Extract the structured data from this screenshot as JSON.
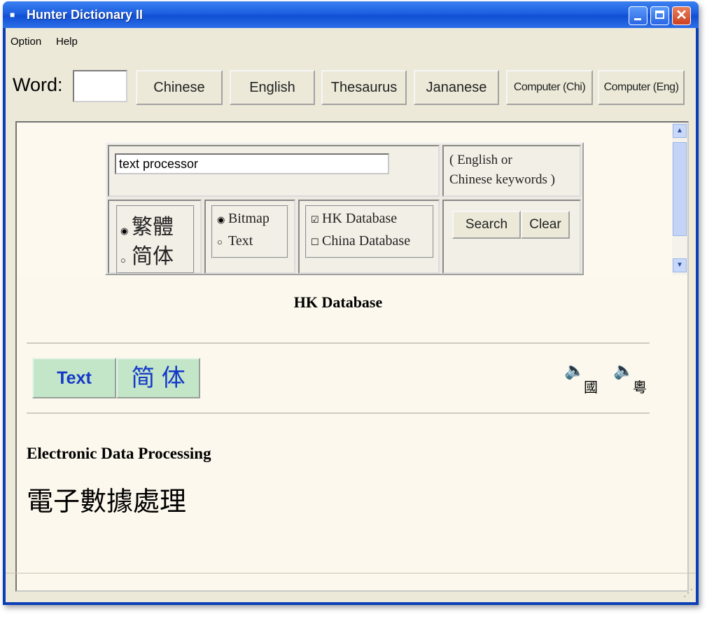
{
  "window": {
    "title": "Hunter Dictionary II",
    "close_glyph": "✕"
  },
  "menu": {
    "items": [
      "Option",
      "Help"
    ]
  },
  "toolbar": {
    "word_label": "Word:",
    "word_value": "",
    "buttons": [
      "Chinese",
      "English",
      "Thesaurus",
      "Jananese",
      "Computer (Chi)",
      "Computer (Eng)"
    ]
  },
  "search": {
    "query": "text processor",
    "hint_line1": "( English or",
    "hint_line2": "Chinese keywords )",
    "script_options": {
      "traditional": "繁體",
      "simplified": "简体",
      "selected": "traditional"
    },
    "render_options": {
      "bitmap": "Bitmap",
      "text": "Text",
      "selected": "bitmap"
    },
    "databases": {
      "hk": "HK Database",
      "china": "China Database",
      "hk_checked": true,
      "china_checked": false
    },
    "search_label": "Search",
    "clear_label": "Clear"
  },
  "result": {
    "database_title": "HK Database",
    "mode_text": "Text",
    "mode_simplified": "简 体",
    "pron_mandarin": "國",
    "pron_cantonese": "粵",
    "term_english": "Electronic Data Processing",
    "term_chinese": "電子數據處理"
  },
  "icons": {
    "speaker": "speaker-icon",
    "app": "book-icon"
  },
  "colors": {
    "titlebar": "#1d5fe0",
    "mode_button_bg": "#c3e6c9",
    "mode_button_text": "#1438c8",
    "content_bg": "#fcf8ed"
  }
}
